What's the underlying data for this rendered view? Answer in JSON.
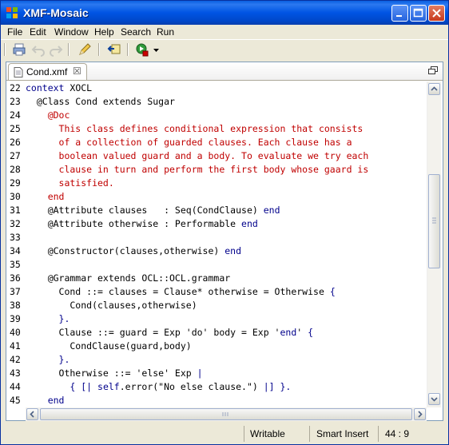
{
  "window": {
    "title": "XMF-Mosaic"
  },
  "menu": [
    "File",
    "Edit",
    "Window",
    "Help",
    "Search",
    "Run"
  ],
  "editor": {
    "tab_label": "Cond.xmf",
    "tab_close": "☒",
    "lines": [
      {
        "num": "22",
        "segs": [
          {
            "t": "context",
            "c": "kw"
          },
          {
            "t": " XOCL",
            "c": "blk"
          }
        ]
      },
      {
        "num": "23",
        "segs": [
          {
            "t": "  @Class Cond extends Sugar",
            "c": "blk"
          }
        ]
      },
      {
        "num": "24",
        "segs": [
          {
            "t": "    @Doc",
            "c": "red"
          }
        ]
      },
      {
        "num": "25",
        "segs": [
          {
            "t": "      This class defines conditional expression that consists",
            "c": "red"
          }
        ]
      },
      {
        "num": "26",
        "segs": [
          {
            "t": "      of a collection of guarded clauses. Each clause has a",
            "c": "red"
          }
        ]
      },
      {
        "num": "27",
        "segs": [
          {
            "t": "      boolean valued guard and a body. To evaluate we try each",
            "c": "red"
          }
        ]
      },
      {
        "num": "28",
        "segs": [
          {
            "t": "      clause in turn and perform the first body whose gaard is",
            "c": "red"
          }
        ]
      },
      {
        "num": "29",
        "segs": [
          {
            "t": "      satisfied.",
            "c": "red"
          }
        ]
      },
      {
        "num": "30",
        "segs": [
          {
            "t": "    end",
            "c": "red"
          }
        ]
      },
      {
        "num": "31",
        "segs": [
          {
            "t": "    @Attribute clauses   : Seq(CondClause) ",
            "c": "blk"
          },
          {
            "t": "end",
            "c": "kw"
          }
        ]
      },
      {
        "num": "32",
        "segs": [
          {
            "t": "    @Attribute otherwise : Performable ",
            "c": "blk"
          },
          {
            "t": "end",
            "c": "kw"
          }
        ]
      },
      {
        "num": "33",
        "segs": [
          {
            "t": "",
            "c": "blk"
          }
        ]
      },
      {
        "num": "34",
        "segs": [
          {
            "t": "    @Constructor(clauses,otherwise) ",
            "c": "blk"
          },
          {
            "t": "end",
            "c": "kw"
          }
        ]
      },
      {
        "num": "35",
        "segs": [
          {
            "t": "",
            "c": "blk"
          }
        ]
      },
      {
        "num": "36",
        "segs": [
          {
            "t": "    @Grammar extends OCL::OCL.grammar",
            "c": "blk"
          }
        ]
      },
      {
        "num": "37",
        "segs": [
          {
            "t": "      Cond ::= clauses = Clause* otherwise = Otherwise ",
            "c": "blk"
          },
          {
            "t": "{",
            "c": "kw"
          }
        ]
      },
      {
        "num": "38",
        "segs": [
          {
            "t": "        Cond(clauses,otherwise)",
            "c": "blk"
          }
        ]
      },
      {
        "num": "39",
        "segs": [
          {
            "t": "      }.",
            "c": "kw"
          }
        ]
      },
      {
        "num": "40",
        "segs": [
          {
            "t": "      Clause ::= guard = Exp 'do' body = Exp '",
            "c": "blk"
          },
          {
            "t": "end",
            "c": "kw"
          },
          {
            "t": "' ",
            "c": "blk"
          },
          {
            "t": "{",
            "c": "kw"
          }
        ]
      },
      {
        "num": "41",
        "segs": [
          {
            "t": "        CondClause(guard,body)",
            "c": "blk"
          }
        ]
      },
      {
        "num": "42",
        "segs": [
          {
            "t": "      }.",
            "c": "kw"
          }
        ]
      },
      {
        "num": "43",
        "segs": [
          {
            "t": "      Otherwise ::= 'else' Exp ",
            "c": "blk"
          },
          {
            "t": "|",
            "c": "kw"
          }
        ]
      },
      {
        "num": "44",
        "segs": [
          {
            "t": "        ",
            "c": "blk"
          },
          {
            "t": "{ [| ",
            "c": "kw"
          },
          {
            "t": "self",
            "c": "kw"
          },
          {
            "t": ".error(\"No else clause.\") ",
            "c": "blk"
          },
          {
            "t": "|] }.",
            "c": "kw"
          }
        ]
      },
      {
        "num": "45",
        "segs": [
          {
            "t": "    end",
            "c": "kw"
          }
        ]
      }
    ]
  },
  "status": {
    "mode": "Writable",
    "insert": "Smart Insert",
    "position": "44 : 9"
  }
}
